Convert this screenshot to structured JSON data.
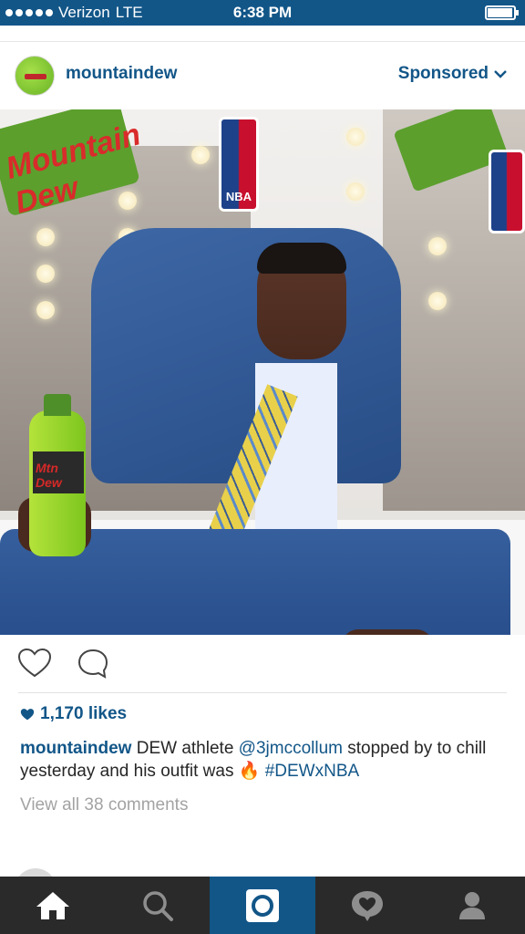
{
  "status_bar": {
    "carrier": "Verizon",
    "network": "LTE",
    "time": "6:38 PM"
  },
  "post": {
    "username": "mountaindew",
    "sponsored_label": "Sponsored",
    "photo": {
      "logo_text": "Mountain Dew",
      "nba_logo_text": "NBA",
      "bottle_label": "Mtn Dew"
    },
    "likes": "1,170 likes",
    "caption": {
      "user": "mountaindew",
      "text_before": " DEW athlete ",
      "mention": "@3jmccollum",
      "text_after": " stopped by to chill yesterday and his outfit was ",
      "emoji": "🔥",
      "hashtag": " #DEWxNBA"
    },
    "view_comments": "View all 38 comments"
  },
  "tabs": [
    {
      "icon": "home-icon"
    },
    {
      "icon": "search-icon"
    },
    {
      "icon": "camera-icon"
    },
    {
      "icon": "activity-heart-icon"
    },
    {
      "icon": "profile-icon"
    }
  ],
  "colors": {
    "brand_blue": "#125688",
    "tab_bar": "#2a2a2a"
  }
}
